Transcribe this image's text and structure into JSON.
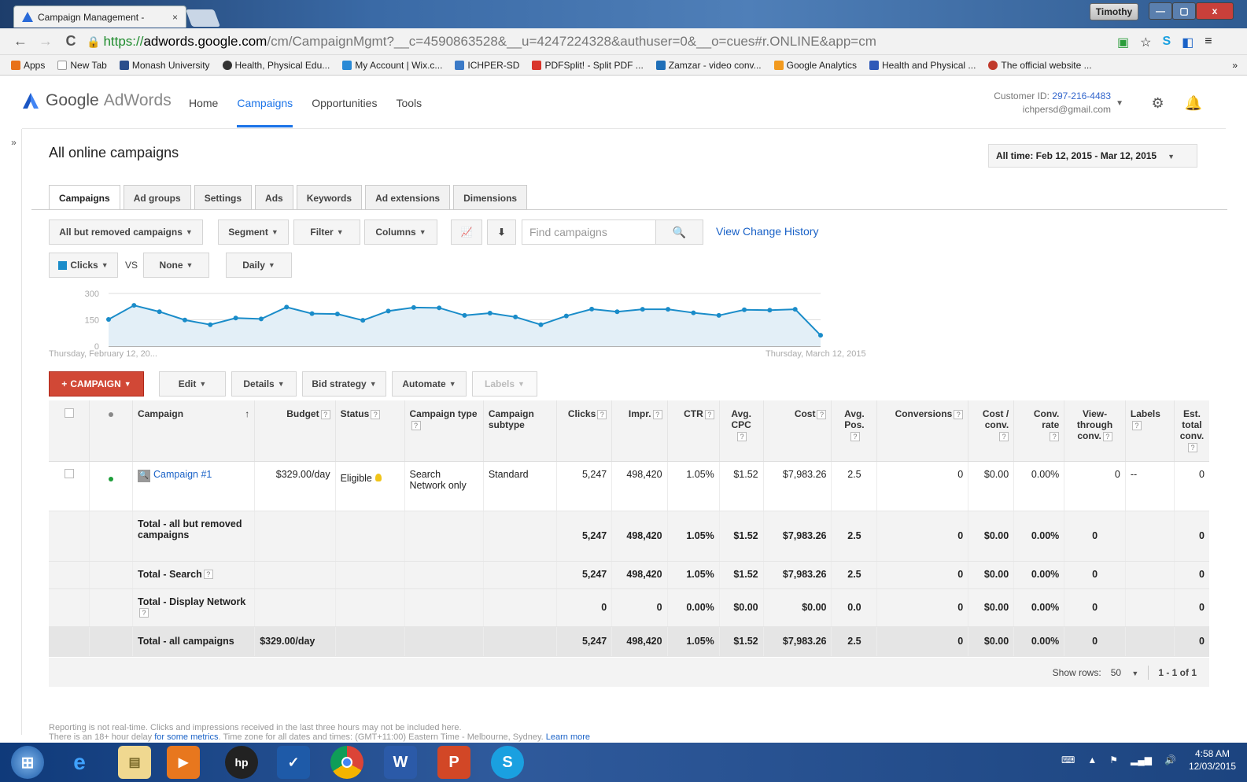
{
  "browser": {
    "tab_title": "Campaign Management -",
    "tab_close": "×",
    "user_tag": "Timothy",
    "url_scheme": "https://",
    "url_host": "adwords.google.com",
    "url_path": "/cm/CampaignMgmt?__c=4590863528&__u=4247224328&authuser=0&__o=cues#r.ONLINE&app=cm",
    "bookmarks": [
      "Apps",
      "New Tab",
      "Monash University",
      "Health, Physical Edu...",
      "My Account | Wix.c...",
      "ICHPER-SD",
      "PDFSplit! - Split PDF ...",
      "Zamzar - video conv...",
      "Google Analytics",
      "Health and Physical ...",
      "The official website ..."
    ],
    "bookmarks_more": "»"
  },
  "header": {
    "logo_google": "Google",
    "logo_adwords": "AdWords",
    "nav": [
      "Home",
      "Campaigns",
      "Opportunities",
      "Tools"
    ],
    "customer_id_label": "Customer ID:",
    "customer_id": "297-216-4483",
    "email": "ichpersd@gmail.com"
  },
  "sidebar_toggle": "»",
  "page": {
    "title": "All online campaigns",
    "date_range": "All time: Feb 12, 2015 - Mar 12, 2015"
  },
  "subtabs": [
    "Campaigns",
    "Ad groups",
    "Settings",
    "Ads",
    "Keywords",
    "Ad extensions",
    "Dimensions"
  ],
  "toolbar": {
    "filter_scope": "All but removed campaigns",
    "segment": "Segment",
    "filter": "Filter",
    "columns": "Columns",
    "search_placeholder": "Find campaigns",
    "view_change_history": "View Change History",
    "metric1": "Clicks",
    "vs": "VS",
    "metric2": "None",
    "period": "Daily"
  },
  "chart_data": {
    "type": "area",
    "metric": "Clicks",
    "yticks": [
      "300",
      "150",
      "0"
    ],
    "ylim": [
      0,
      300
    ],
    "x_start_label": "Thursday, February 12, 20...",
    "x_end_label": "Thursday, March 12, 2015",
    "values": [
      152,
      232,
      196,
      149,
      122,
      160,
      155,
      222,
      185,
      183,
      147,
      200,
      220,
      218,
      175,
      188,
      166,
      122,
      172,
      211,
      196,
      210,
      210,
      190,
      175,
      207,
      205,
      210,
      62
    ],
    "color": "#1a8cc9"
  },
  "actions": {
    "campaign": "CAMPAIGN",
    "edit": "Edit",
    "details": "Details",
    "bid_strategy": "Bid strategy",
    "automate": "Automate",
    "labels": "Labels"
  },
  "table": {
    "headers": {
      "campaign": "Campaign",
      "budget": "Budget",
      "status": "Status",
      "type": "Campaign type",
      "subtype": "Campaign subtype",
      "clicks": "Clicks",
      "impr": "Impr.",
      "ctr": "CTR",
      "avg_cpc": "Avg. CPC",
      "cost": "Cost",
      "avg_pos": "Avg. Pos.",
      "conversions": "Conversions",
      "cost_conv": "Cost / conv.",
      "conv_rate": "Conv. rate",
      "view_through": "View-through conv.",
      "labels": "Labels",
      "est_total": "Est. total conv."
    },
    "campaign_row": {
      "name": "Campaign #1",
      "budget": "$329.00/day",
      "status": "Eligible",
      "type": "Search Network only",
      "subtype": "Standard",
      "clicks": "5,247",
      "impr": "498,420",
      "ctr": "1.05%",
      "avg_cpc": "$1.52",
      "cost": "$7,983.26",
      "avg_pos": "2.5",
      "conversions": "0",
      "cost_conv": "$0.00",
      "conv_rate": "0.00%",
      "view_through": "0",
      "labels": "--",
      "est_total": "0"
    },
    "totals": [
      {
        "label": "Total - all but removed campaigns",
        "budget": "",
        "clicks": "5,247",
        "impr": "498,420",
        "ctr": "1.05%",
        "avg_cpc": "$1.52",
        "cost": "$7,983.26",
        "avg_pos": "2.5",
        "conversions": "0",
        "cost_conv": "$0.00",
        "conv_rate": "0.00%",
        "view_through": "0",
        "est_total": "0"
      },
      {
        "label": "Total - Search",
        "budget": "",
        "clicks": "5,247",
        "impr": "498,420",
        "ctr": "1.05%",
        "avg_cpc": "$1.52",
        "cost": "$7,983.26",
        "avg_pos": "2.5",
        "conversions": "0",
        "cost_conv": "$0.00",
        "conv_rate": "0.00%",
        "view_through": "0",
        "est_total": "0"
      },
      {
        "label": "Total - Display Network",
        "budget": "",
        "clicks": "0",
        "impr": "0",
        "ctr": "0.00%",
        "avg_cpc": "$0.00",
        "cost": "$0.00",
        "avg_pos": "0.0",
        "conversions": "0",
        "cost_conv": "$0.00",
        "conv_rate": "0.00%",
        "view_through": "0",
        "est_total": "0"
      },
      {
        "label": "Total - all campaigns",
        "budget": "$329.00/day",
        "clicks": "5,247",
        "impr": "498,420",
        "ctr": "1.05%",
        "avg_cpc": "$1.52",
        "cost": "$7,983.26",
        "avg_pos": "2.5",
        "conversions": "0",
        "cost_conv": "$0.00",
        "conv_rate": "0.00%",
        "view_through": "0",
        "est_total": "0"
      }
    ]
  },
  "pagination": {
    "show_rows_label": "Show rows:",
    "rows": "50",
    "range": "1 - 1 of 1"
  },
  "footer": {
    "line1": "Reporting is not real-time. Clicks and impressions received in the last three hours may not be included here.",
    "line2_a": "There is an 18+ hour delay ",
    "line2_link": "for some metrics",
    "line2_b": ". Time zone for all dates and times: (GMT+11:00) Eastern Time - Melbourne, Sydney. ",
    "learn_more": "Learn more"
  },
  "taskbar": {
    "time": "4:58 AM",
    "date": "12/03/2015"
  }
}
